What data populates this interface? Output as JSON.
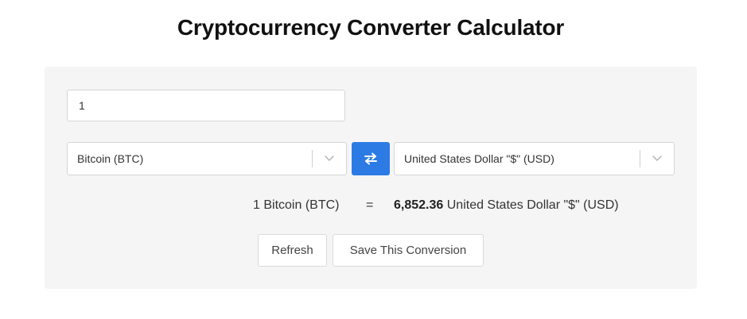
{
  "page": {
    "title": "Cryptocurrency Converter Calculator"
  },
  "converter": {
    "amount_value": "1",
    "from_currency": "Bitcoin (BTC)",
    "to_currency": "United States Dollar \"$\" (USD)",
    "swap_icon": "swap-arrows-icon",
    "dropdown_icon": "chevron-down-icon",
    "accent_color": "#2c7be5"
  },
  "result": {
    "from_text": "1 Bitcoin (BTC)",
    "equals": "=",
    "amount": "6,852.36",
    "to_text": "United States Dollar \"$\" (USD)"
  },
  "actions": {
    "refresh_label": "Refresh",
    "save_label": "Save This Conversion"
  }
}
